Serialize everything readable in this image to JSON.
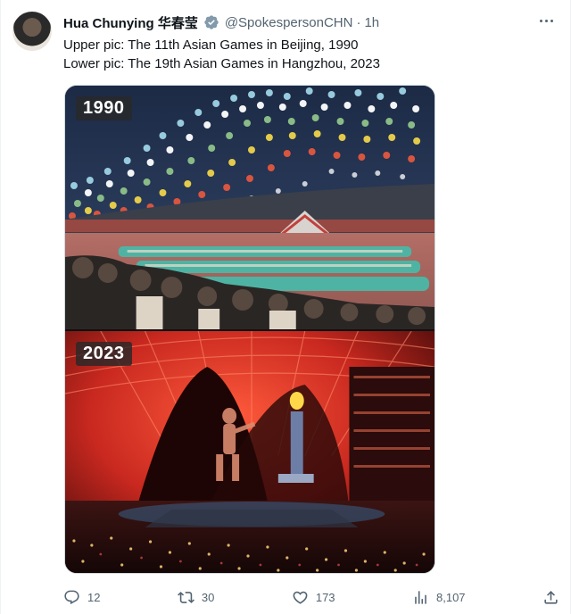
{
  "tweet": {
    "author_name": "Hua Chunying 华春莹",
    "handle": "@SpokespersonCHN",
    "separator": "·",
    "time": "1h",
    "text_lines": [
      "Upper pic: The 11th Asian Games in Beijing, 1990",
      "Lower pic: The 19th Asian Games in Hangzhou, 2023"
    ],
    "images": [
      {
        "badge": "1990"
      },
      {
        "badge": "2023"
      }
    ],
    "actions": {
      "replies": "12",
      "retweets": "30",
      "likes": "173",
      "views": "8,107"
    }
  },
  "icons": {
    "verified": "verified-badge-icon",
    "more": "more-options-icon",
    "reply": "reply-icon",
    "retweet": "retweet-icon",
    "like": "heart-icon",
    "views": "views-chart-icon",
    "share": "share-icon"
  },
  "colors": {
    "verified_badge": "#829aab",
    "secondary_text": "#536471",
    "primary_text": "#0f1419",
    "border": "#cfd9de"
  }
}
